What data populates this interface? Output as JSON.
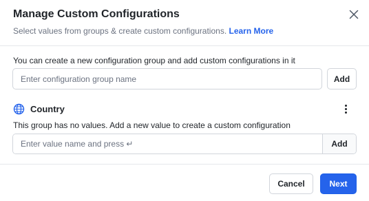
{
  "dialog": {
    "title": "Manage Custom Configurations",
    "subtitle": "Select values from groups & create custom configurations.",
    "learn_more": "Learn More",
    "close_icon": "close-icon"
  },
  "new_group": {
    "instruction": "You can create a new configuration group and add custom configurations in it",
    "input_value": "",
    "input_placeholder": "Enter configuration group name",
    "add_label": "Add"
  },
  "group": {
    "icon": "globe-icon",
    "name": "Country",
    "empty_message": "This group has no values. Add a new value to create a custom configuration",
    "value_input": "",
    "value_placeholder": "Enter value name and press ↵",
    "add_label": "Add",
    "menu_icon": "more-vertical-icon"
  },
  "footer": {
    "cancel_label": "Cancel",
    "next_label": "Next"
  },
  "colors": {
    "primary": "#2563eb",
    "link": "#2563eb",
    "border": "#d1d5db",
    "muted_text": "#6b7280",
    "text": "#1f2328"
  }
}
